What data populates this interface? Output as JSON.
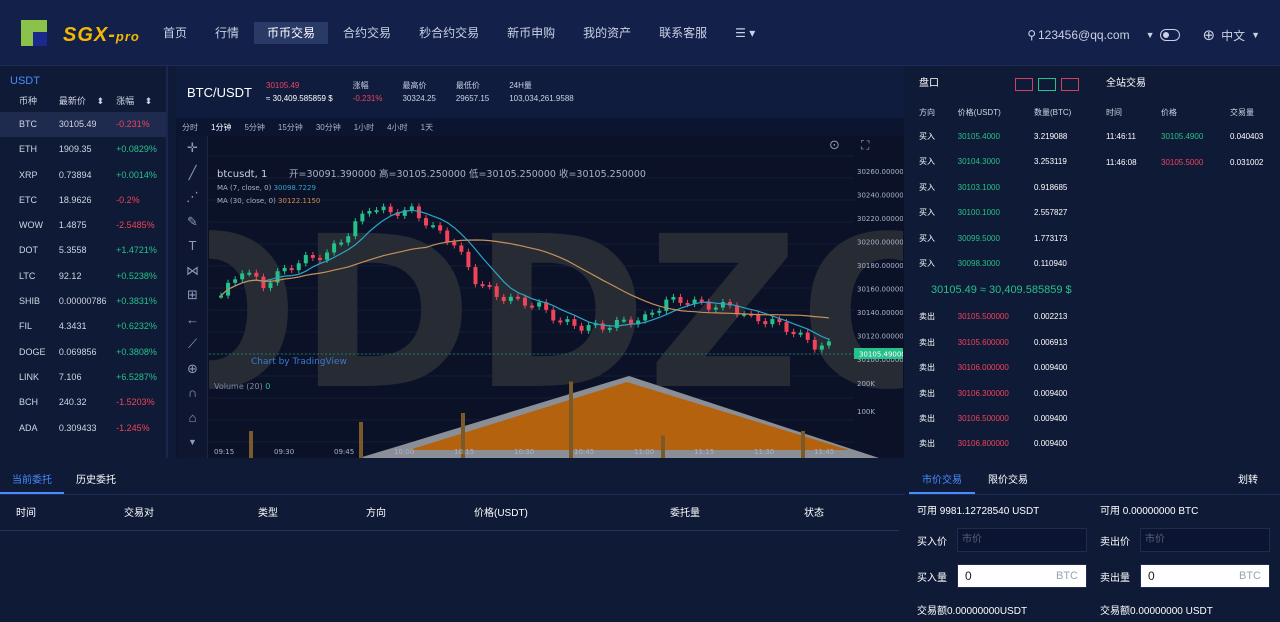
{
  "nav": {
    "logo_text": "SGX-",
    "logo_sub": "pro",
    "menu": [
      "首页",
      "行情",
      "币币交易",
      "合约交易",
      "秒合约交易",
      "新币申购",
      "我的资产",
      "联系客服"
    ],
    "menu_more_icon": "list-icon",
    "user": "123456@qq.com",
    "language": "中文"
  },
  "market_list": {
    "title": "USDT",
    "columns": [
      "币种",
      "最新价",
      "涨幅"
    ],
    "rows": [
      {
        "coin": "BTC",
        "price": "30105.49",
        "change": "-0.231%"
      },
      {
        "coin": "ETH",
        "price": "1909.35",
        "change": "+0.0829%"
      },
      {
        "coin": "XRP",
        "price": "0.73894",
        "change": "+0.0014%"
      },
      {
        "coin": "ETC",
        "price": "18.9626",
        "change": "-0.2%"
      },
      {
        "coin": "WOW",
        "price": "1.4875",
        "change": "-2.5485%"
      },
      {
        "coin": "DOT",
        "price": "5.3558",
        "change": "+1.4721%"
      },
      {
        "coin": "LTC",
        "price": "92.12",
        "change": "+0.5238%"
      },
      {
        "coin": "SHIB",
        "price": "0.00000786",
        "change": "+0.3831%"
      },
      {
        "coin": "FIL",
        "price": "4.3431",
        "change": "+0.6232%"
      },
      {
        "coin": "DOGE",
        "price": "0.069856",
        "change": "+0.3808%"
      },
      {
        "coin": "LINK",
        "price": "7.106",
        "change": "+6.5287%"
      },
      {
        "coin": "BCH",
        "price": "240.32",
        "change": "-1.5203%"
      },
      {
        "coin": "ADA",
        "price": "0.309433",
        "change": "-1.245%"
      }
    ]
  },
  "ticker": {
    "pair": "BTC/USDT",
    "price": "30105.49",
    "price_usd": "≈ 30,409.585859 $",
    "change_label": "涨幅",
    "change": "-0.231%",
    "high_label": "最高价",
    "high": "30324.25",
    "low_label": "最低价",
    "low": "29657.15",
    "vol_label": "24H量",
    "vol": "103,034,261.9588"
  },
  "intervals": [
    "分时",
    "1分钟",
    "5分钟",
    "15分钟",
    "30分钟",
    "1小时",
    "4小时",
    "1天"
  ],
  "chart": {
    "symbol_line": "btcusdt, 1",
    "ohlc": "开=30091.390000  高=30105.250000  低=30105.250000  收=30105.250000",
    "ma7_label": "MA (7, close, 0)",
    "ma7": "30098.7229",
    "ma30_label": "MA (30, close, 0)",
    "ma30": "30122.1150",
    "volume_label": "Volume (20)",
    "volume_value": "0",
    "watermark": "Chart by TradingView",
    "last_price_tag": "30105.490000",
    "y_ticks": [
      "30260.000000",
      "30240.000000",
      "30220.000000",
      "30200.000000",
      "30180.000000",
      "30160.000000",
      "30140.000000",
      "30120.000000",
      "30100.000000",
      "200K",
      "100K"
    ],
    "x_ticks": [
      "09:15",
      "09:30",
      "09:45",
      "10:00",
      "10:15",
      "10:30",
      "10:45",
      "11:00",
      "11:15",
      "11:30",
      "11:45"
    ],
    "overlay_text": "ODDZO"
  },
  "chart_data": {
    "type": "candlestick",
    "symbol": "btcusdt",
    "interval": "1",
    "x_ticks": [
      "09:15",
      "09:30",
      "09:45",
      "10:00",
      "10:15",
      "10:30",
      "10:45",
      "11:00",
      "11:15",
      "11:30",
      "11:45"
    ],
    "ylim": [
      30100,
      30260
    ],
    "close_approx": [
      30150,
      30175,
      30160,
      30175,
      30185,
      30190,
      30210,
      30235,
      30230,
      30232,
      30215,
      30200,
      30165,
      30150,
      30145,
      30140,
      30125,
      30120,
      30120,
      30125,
      30128,
      30145,
      30145,
      30140,
      30140,
      30128,
      30125,
      30115,
      30102
    ],
    "series": [
      {
        "name": "MA (7, close, 0)",
        "last": 30098.7229
      },
      {
        "name": "MA (30, close, 0)",
        "last": 30122.115
      }
    ]
  },
  "orderbook": {
    "title": "盘口",
    "columns": [
      "方向",
      "价格(USDT)",
      "数量(BTC)"
    ],
    "buys": [
      {
        "side": "买入",
        "price": "30105.4000",
        "qty": "3.219088"
      },
      {
        "side": "买入",
        "price": "30104.3000",
        "qty": "3.253119"
      },
      {
        "side": "买入",
        "price": "30103.1000",
        "qty": "0.918685"
      },
      {
        "side": "买入",
        "price": "30100.1000",
        "qty": "2.557827"
      },
      {
        "side": "买入",
        "price": "30099.5000",
        "qty": "1.773173"
      },
      {
        "side": "买入",
        "price": "30098.3000",
        "qty": "0.110940"
      }
    ],
    "mid": "30105.49 ≈ 30,409.585859 $",
    "sells": [
      {
        "side": "卖出",
        "price": "30105.500000",
        "qty": "0.002213"
      },
      {
        "side": "卖出",
        "price": "30105.600000",
        "qty": "0.006913"
      },
      {
        "side": "卖出",
        "price": "30106.000000",
        "qty": "0.009400"
      },
      {
        "side": "卖出",
        "price": "30106.300000",
        "qty": "0.009400"
      },
      {
        "side": "卖出",
        "price": "30106.500000",
        "qty": "0.009400"
      },
      {
        "side": "卖出",
        "price": "30106.800000",
        "qty": "0.009400"
      }
    ]
  },
  "trades": {
    "title": "全站交易",
    "columns": [
      "时间",
      "价格",
      "交易量"
    ],
    "rows": [
      {
        "time": "11:46:11",
        "price": "30105.4900",
        "qty": "0.040403",
        "dir": "up"
      },
      {
        "time": "11:46:08",
        "price": "30105.5000",
        "qty": "0.031002",
        "dir": "down"
      }
    ]
  },
  "orders": {
    "tabs": [
      "当前委托",
      "历史委托"
    ],
    "columns": [
      "时间",
      "交易对",
      "类型",
      "方向",
      "价格(USDT)",
      "委托量",
      "状态"
    ]
  },
  "trade_form": {
    "tabs": [
      "市价交易",
      "限价交易"
    ],
    "transfer": "划转",
    "buy": {
      "available": "可用 9981.12728540 USDT",
      "price_label": "买入价",
      "price_placeholder": "市价",
      "qty_label": "买入量",
      "qty": "0",
      "qty_unit": "BTC",
      "amount": "交易额0.00000000USDT"
    },
    "sell": {
      "available": "可用 0.00000000 BTC",
      "price_label": "卖出价",
      "price_placeholder": "市价",
      "qty_label": "卖出量",
      "qty": "0",
      "qty_unit": "BTC",
      "amount": "交易额0.00000000 USDT"
    }
  },
  "colors": {
    "up": "#26c08a",
    "down": "#f0445a",
    "accent": "#4a8cff",
    "nav_bg": "#13204a"
  }
}
